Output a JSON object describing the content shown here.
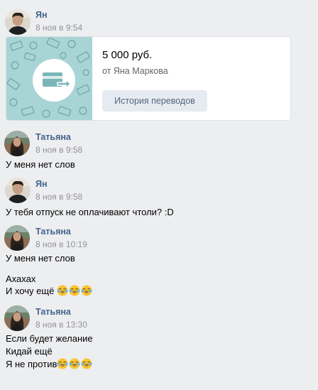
{
  "messages": [
    {
      "author": "Ян",
      "time": "8 ноя в 9:54"
    },
    {
      "author": "Татьяна",
      "time": "8 ноя в 9:58",
      "lines": [
        "У меня нет слов"
      ]
    },
    {
      "author": "Ян",
      "time": "8 ноя в 9:58",
      "lines": [
        "У тебя отпуск не оплачивают чтоли? :D"
      ]
    },
    {
      "author": "Татьяна",
      "time": "8 ноя в 10:19",
      "lines": [
        "У меня нет слов",
        "Ахахах",
        "И хочу ещё"
      ]
    },
    {
      "author": "Татьяна",
      "time": "8 ноя в 13:30",
      "lines": [
        "Если будет желание",
        "Кидай ещё",
        "Я не против"
      ]
    }
  ],
  "transfer": {
    "amount": "5 000 руб.",
    "from": "от Яна Маркова",
    "history_button": "История переводов"
  },
  "colors": {
    "author": "#42648b",
    "background": "#edeef0",
    "card_pattern": "#a8d4d6",
    "button_bg": "#e5ebf1"
  },
  "icons": {
    "emoji": "face-with-tears-of-joy",
    "transfer": "card-transfer-icon"
  }
}
